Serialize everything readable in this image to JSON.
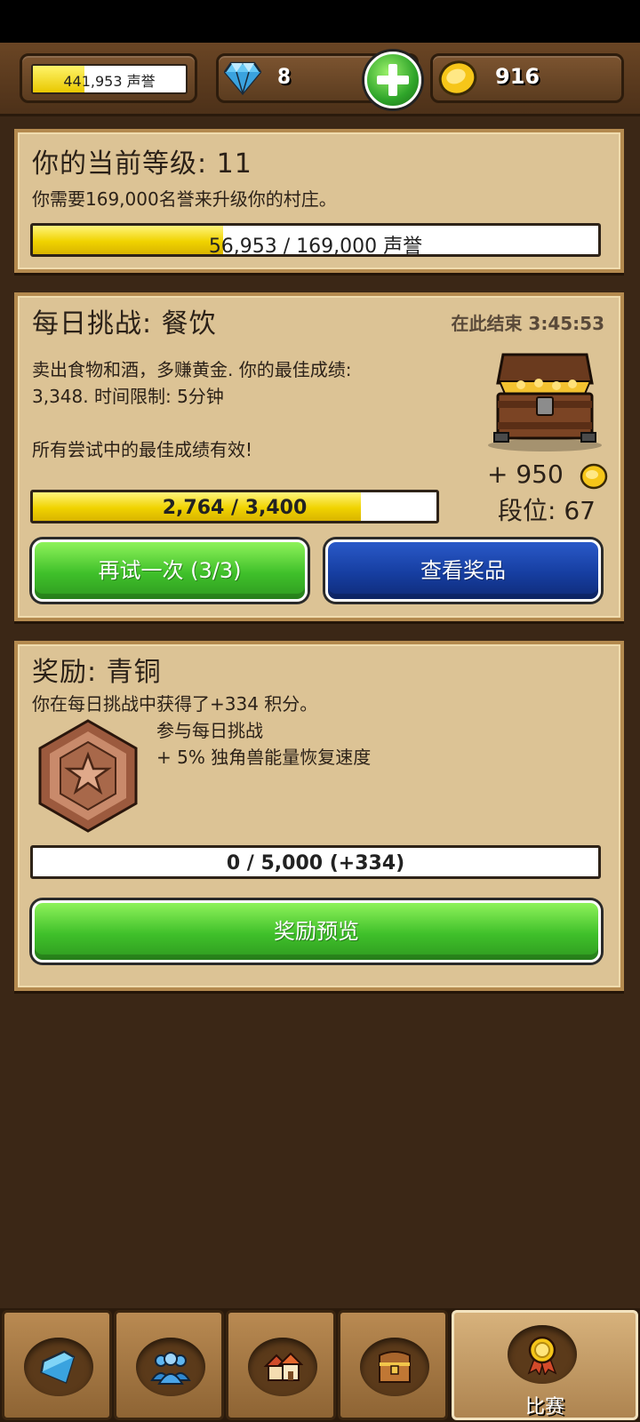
{
  "topbar": {
    "fame": {
      "text": "441,953 声誉",
      "fill": 0.34
    },
    "gems": "8",
    "gold": "916"
  },
  "level_panel": {
    "title": "你的当前等级: 11",
    "description": "你需要169,000名誉来升级你的村庄。",
    "progress": {
      "text": "56,953 / 169,000 声誉",
      "fill": 0.337
    }
  },
  "daily_panel": {
    "title": "每日挑战: 餐饮",
    "timer": "在此结束 3:45:53",
    "description_line1": "卖出食物和酒，多赚黄金. 你的最佳成绩:",
    "description_line2": "3,348. 时间限制: 5分钟",
    "note": "所有尝试中的最佳成绩有效!",
    "reward": "+ 950",
    "rank": "段位: 67",
    "progress": {
      "text": "2,764 / 3,400",
      "fill": 0.813
    },
    "retry_label": "再试一次 (3/3)",
    "view_prizes_label": "查看奖品"
  },
  "reward_panel": {
    "title": "奖励: 青铜",
    "description": "你在每日挑战中获得了+334 积分。",
    "perk_line1": "参与每日挑战",
    "perk_line2": "+ 5% 独角兽能量恢复速度",
    "progress": {
      "text": "0 / 5,000 (+334)",
      "fill": 0
    },
    "preview_label": "奖励预览"
  },
  "nav": {
    "tabs": [
      {
        "icon": "gem-icon"
      },
      {
        "icon": "people-icon"
      },
      {
        "icon": "village-icon"
      },
      {
        "icon": "chest-icon"
      },
      {
        "icon": "medal-icon",
        "label": "比赛",
        "active": true
      }
    ]
  }
}
